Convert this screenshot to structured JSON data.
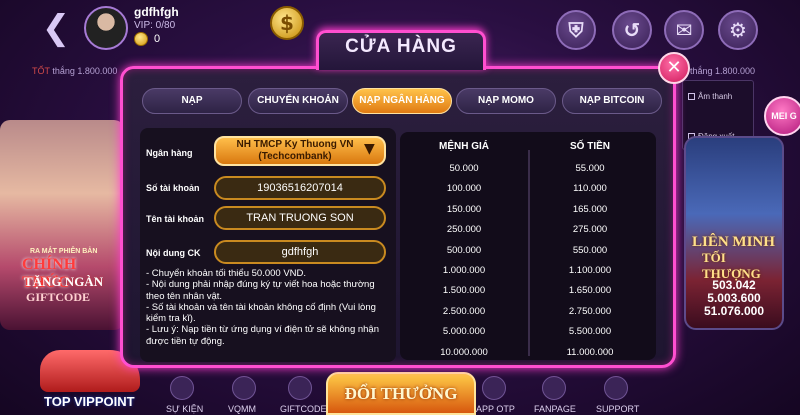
{
  "header": {
    "back_icon": "chevron-left-icon",
    "username": "gdfhfgh",
    "vip_text": "VIP: 0/80",
    "coins": "0",
    "jackpot_left_prefix": "TỐT",
    "jackpot_left": "thắng 1.800.000",
    "jackpot_right": "thắng 1.800.000",
    "round_buttons": [
      "shield-icon",
      "history-icon",
      "mail-icon",
      "gear-icon"
    ]
  },
  "settings": {
    "items": [
      "Âm thanh",
      "Đăng xuất"
    ]
  },
  "left_banner": {
    "line1": "RA MẮT PHIÊN BẢN",
    "line2": "CHÍNH THỨC",
    "line3": "TẶNG NGÀN",
    "line4": "GIFTCODE"
  },
  "right_banner": {
    "mini_label": "MEI G",
    "title1": "LIÊN MINH",
    "title2": "TỐI THƯỢNG",
    "numbers": [
      "503.042",
      "5.003.600",
      "51.076.000"
    ]
  },
  "bottom": {
    "top_vip": "TOP VIPPOINT",
    "items": [
      "SỰ KIỆN",
      "VQMM",
      "GIFTCODE",
      "APP OTP",
      "FANPAGE",
      "SUPPORT"
    ],
    "doi_thuong": "ĐỔI THƯỞNG"
  },
  "modal": {
    "title": "CỬA HÀNG",
    "close_icon": "close-icon",
    "tabs": [
      "NẠP",
      "CHUYỂN KHOẢN",
      "NẠP NGÂN HÀNG",
      "NẠP MOMO",
      "NẠP BITCOIN"
    ],
    "active_tab": "NẠP NGÂN HÀNG",
    "form": {
      "bank_label": "Ngân hàng",
      "bank_value_line1": "NH TMCP Ky Thuong VN",
      "bank_value_line2": "(Techcombank)",
      "account_no_label": "Số tài khoản",
      "account_no": "19036516207014",
      "account_name_label": "Tên tài khoản",
      "account_name": "TRAN TRUONG SON",
      "content_label": "Nội dung CK",
      "content": "gdfhfgh",
      "notes": [
        "- Chuyển khoản tối thiểu 50.000 VND.",
        "- Nội dung phải nhập đúng ký tự viết hoa hoặc thường",
        "theo tên nhân vật.",
        "- Số tài khoản và tên tài khoản không cố định (Vui lòng",
        "kiểm tra kĩ).",
        "- Lưu ý: Nạp tiền từ ứng dụng ví điện tử sẽ không nhận",
        "được tiền tự động."
      ]
    },
    "rates": {
      "col1": "MỆNH GIÁ",
      "col2": "SỐ TIỀN",
      "rows": [
        [
          "50.000",
          "55.000"
        ],
        [
          "100.000",
          "110.000"
        ],
        [
          "150.000",
          "165.000"
        ],
        [
          "250.000",
          "275.000"
        ],
        [
          "500.000",
          "550.000"
        ],
        [
          "1.000.000",
          "1.100.000"
        ],
        [
          "1.500.000",
          "1.650.000"
        ],
        [
          "2.500.000",
          "2.750.000"
        ],
        [
          "5.000.000",
          "5.500.000"
        ],
        [
          "10.000.000",
          "11.000.000"
        ]
      ]
    }
  },
  "colors": {
    "accent_pink": "#ff4fd0",
    "tab_active": "#ffc24a",
    "field_border": "#c98a20"
  }
}
